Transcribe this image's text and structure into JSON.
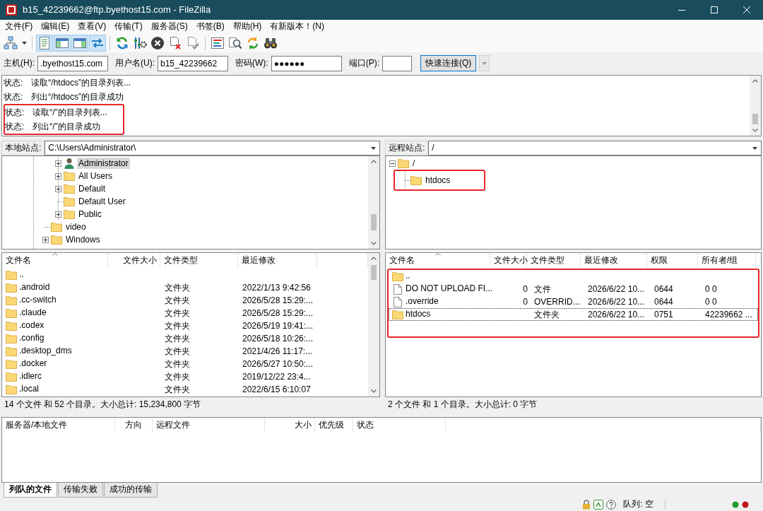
{
  "window": {
    "title": "b15_42239662@ftp.byethost15.com - FileZilla"
  },
  "menu": [
    "文件(F)",
    "编辑(E)",
    "查看(V)",
    "传输(T)",
    "服务器(S)",
    "书签(B)",
    "帮助(H)",
    "有新版本！(N)"
  ],
  "toolbar": {
    "toggles": [
      {
        "pressed": true
      },
      {
        "pressed": true
      },
      {
        "pressed": true
      },
      {
        "pressed": true
      }
    ]
  },
  "quickconnect": {
    "fields": [
      {
        "kind": "host",
        "label": "主机(H):",
        "value": ".byethost15.com"
      },
      {
        "kind": "user",
        "label": "用户名(U):",
        "value": "b15_42239662"
      },
      {
        "kind": "password",
        "label": "密码(W):",
        "value": "●●●●●●"
      },
      {
        "kind": "port",
        "label": "端口(P):"
      }
    ],
    "button": "快速连接(Q)"
  },
  "log": [
    {
      "label": "状态:",
      "message": "读取“/htdocs”的目录列表...",
      "highlighted": false
    },
    {
      "label": "状态:",
      "message": "列出“/htdocs”的目录成功",
      "highlighted": false
    },
    {
      "label": "状态:",
      "message": "读取“/”的目录列表...",
      "highlighted": true
    },
    {
      "label": "状态:",
      "message": "列出“/”的目录成功",
      "highlighted": true
    }
  ],
  "local": {
    "site_label": "本地站点:",
    "path": "C:\\Users\\Administrator\\",
    "tree": [
      {
        "children": [
          {
            "label": "Administrator",
            "kind": "user",
            "expandable": true,
            "expanded": false,
            "selected": true
          },
          {
            "label": "All Users",
            "kind": "folder",
            "expandable": true,
            "expanded": false,
            "selected": false
          },
          {
            "label": "Default",
            "kind": "folder",
            "expandable": true,
            "expanded": false,
            "selected": false
          },
          {
            "label": "Default User",
            "kind": "folder",
            "expandable": false,
            "selected": false
          },
          {
            "label": "Public",
            "kind": "folder",
            "expandable": true,
            "expanded": false,
            "selected": false
          }
        ]
      },
      {
        "label": "video",
        "kind": "folder",
        "expandable": false,
        "selected": false
      },
      {
        "label": "Windows",
        "kind": "folder",
        "expandable": true,
        "expanded": false,
        "selected": false
      }
    ],
    "columns": [
      {
        "label": "文件名",
        "sorted": true
      },
      {
        "label": "文件大小",
        "sorted": false
      },
      {
        "label": "文件类型",
        "sorted": false
      },
      {
        "label": "最近修改",
        "sorted": false
      }
    ],
    "rows": [
      {
        "kind": "folder",
        "name": ".."
      },
      {
        "kind": "folder",
        "name": ".android",
        "type": "文件夹",
        "modified": "2022/1/13 9:42:56"
      },
      {
        "kind": "folder",
        "name": ".cc-switch",
        "type": "文件夹",
        "modified": "2026/5/28 15:29:..."
      },
      {
        "kind": "folder",
        "name": ".claude",
        "type": "文件夹",
        "modified": "2026/5/28 15:29:..."
      },
      {
        "kind": "folder",
        "name": ".codex",
        "type": "文件夹",
        "modified": "2026/5/19 19:41:..."
      },
      {
        "kind": "folder",
        "name": ".config",
        "type": "文件夹",
        "modified": "2026/5/18 10:26:..."
      },
      {
        "kind": "folder",
        "name": ".desktop_dms",
        "type": "文件夹",
        "modified": "2021/4/26 11:17:..."
      },
      {
        "kind": "folder",
        "name": ".docker",
        "type": "文件夹",
        "modified": "2026/5/27 10:50:..."
      },
      {
        "kind": "folder",
        "name": ".idlerc",
        "type": "文件夹",
        "modified": "2019/12/22 23:4..."
      },
      {
        "kind": "folder",
        "name": ".local",
        "type": "文件夹",
        "modified": "2022/6/15 6:10:07"
      }
    ],
    "summary": "14 个文件 和 52 个目录。大小总计: 15,234,800 字节"
  },
  "remote": {
    "site_label": "远程站点:",
    "path": "/",
    "tree": [
      {
        "label": "/",
        "kind": "folder",
        "expandable": true,
        "expanded": true,
        "selected": false,
        "highlighted": false,
        "children": [
          {
            "label": "htdocs",
            "kind": "folder",
            "expandable": false,
            "selected": false,
            "highlighted": true
          }
        ]
      }
    ],
    "columns": [
      {
        "label": "文件名",
        "sorted": true
      },
      {
        "label": "文件大小",
        "sorted": false
      },
      {
        "label": "文件类型",
        "sorted": false
      },
      {
        "label": "最近修改",
        "sorted": false
      },
      {
        "label": "权限",
        "sorted": false
      },
      {
        "label": "所有者/组",
        "sorted": false
      }
    ],
    "rows": [
      {
        "kind": "folder",
        "name": "..",
        "focused": false,
        "highlighted": true
      },
      {
        "kind": "file",
        "name": "DO NOT UPLOAD FI...",
        "size": "0",
        "type": "文件",
        "modified": "2026/6/22 10...",
        "permissions": "0644",
        "owner": "0 0",
        "focused": false,
        "highlighted": true
      },
      {
        "kind": "file",
        "name": ".override",
        "size": "0",
        "type": "OVERRID...",
        "modified": "2026/6/22 10...",
        "permissions": "0644",
        "owner": "0 0",
        "focused": false,
        "highlighted": true
      },
      {
        "kind": "folder",
        "name": "htdocs",
        "type": "文件夹",
        "modified": "2026/6/22 10...",
        "permissions": "0751",
        "owner": "42239662 ...",
        "focused": true,
        "highlighted": true
      }
    ],
    "summary": "2 个文件 和 1 个目录。大小总计: 0 字节"
  },
  "queue": {
    "columns": [
      "服务器/本地文件",
      "方向",
      "远程文件",
      "大小",
      "优先级",
      "状态"
    ]
  },
  "tabs": [
    {
      "label": "列队的文件",
      "selected": true
    },
    {
      "label": "传输失败",
      "selected": false
    },
    {
      "label": "成功的传输",
      "selected": false
    }
  ],
  "status_bar": {
    "queue": "队列: 空"
  }
}
